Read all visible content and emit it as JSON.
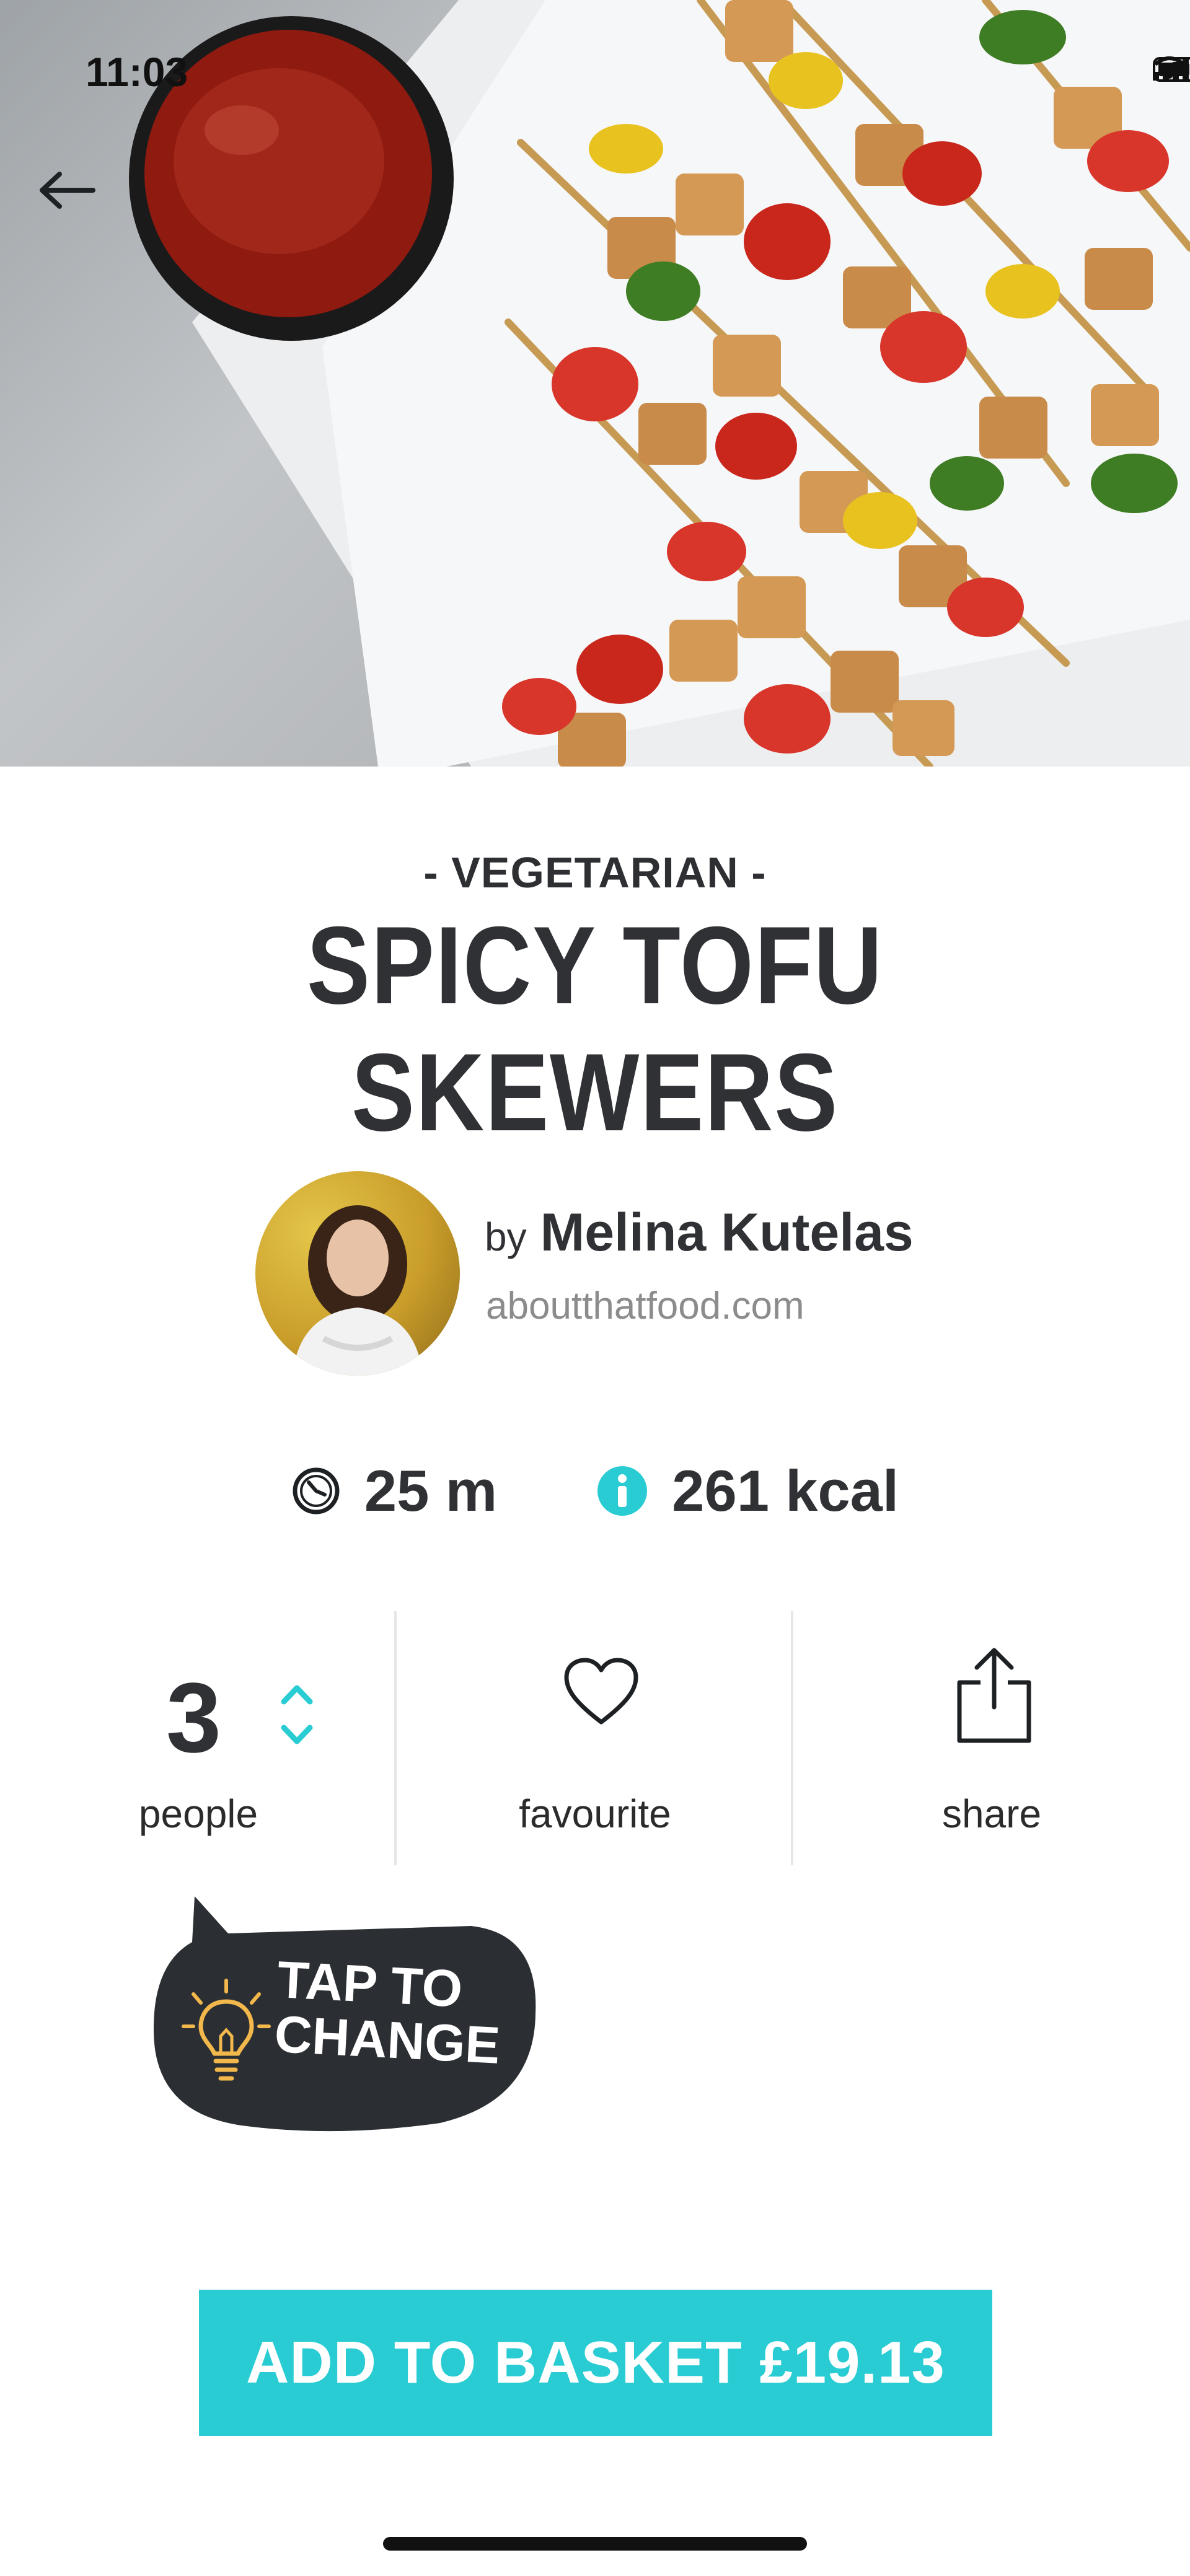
{
  "status_bar": {
    "time": "11:03"
  },
  "recipe": {
    "category": "- VEGETARIAN -",
    "title": "SPICY TOFU SKEWERS"
  },
  "author": {
    "by_label": "by",
    "name": "Melina Kutelas",
    "website": "aboutthatfood.com"
  },
  "stats": {
    "time": "25 m",
    "calories": "261 kcal"
  },
  "actions": {
    "people_count": "3",
    "people_label": "people",
    "favourite_label": "favourite",
    "share_label": "share"
  },
  "tooltip": {
    "line1": "TAP TO",
    "line2": "CHANGE"
  },
  "cta": {
    "label": "ADD TO BASKET £19.13"
  },
  "icons": {
    "back": "arrow-left-icon",
    "clock": "clock-icon",
    "info": "info-icon",
    "stepper": "chevron-up-down-icon",
    "favourite": "heart-icon",
    "share": "share-icon",
    "tip": "lightbulb-icon"
  },
  "colors": {
    "accent": "#29ccd3",
    "text_dark": "#2f3134",
    "text_muted": "#8c8c8c",
    "tooltip_bg": "#2b2f33",
    "tooltip_icon": "#f2b84b"
  }
}
